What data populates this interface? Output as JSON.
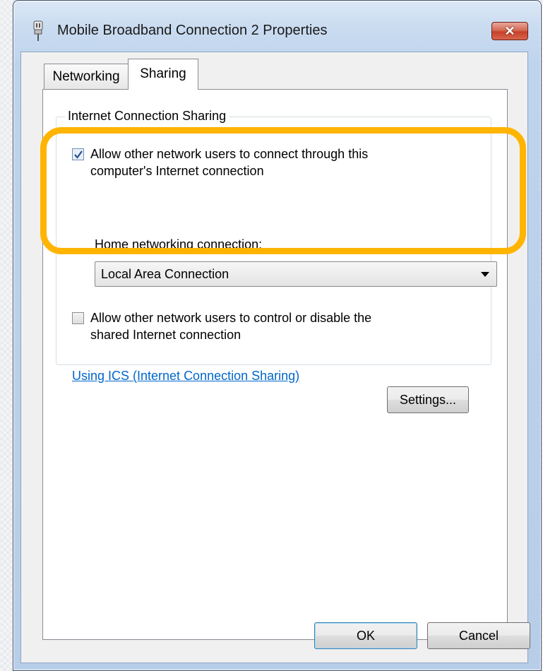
{
  "window": {
    "title": "Mobile Broadband Connection 2 Properties",
    "close_label": "✕"
  },
  "tabs": [
    {
      "label": "Networking",
      "selected": false
    },
    {
      "label": "Sharing",
      "selected": true
    }
  ],
  "sharing": {
    "group_title": "Internet Connection Sharing",
    "allow_connect": {
      "checked": true,
      "line1": "Allow other network users to connect through this",
      "line2": "computer's Internet connection"
    },
    "home_networking_label": "Home networking connection:",
    "home_networking_value": "Local Area Connection",
    "allow_control": {
      "checked": false,
      "line1": "Allow other network users to control or disable the",
      "line2": "shared Internet connection"
    },
    "ics_link": "Using ICS (Internet Connection Sharing)",
    "settings_button": "Settings..."
  },
  "footer": {
    "ok_button": "OK",
    "cancel_button": "Cancel"
  },
  "colors": {
    "highlight": "#ffb400",
    "link": "#0066cc",
    "close_button": "#c7412a"
  },
  "icons": [
    "connection-plug-icon",
    "close-icon",
    "checkmark-icon",
    "dropdown-arrow-icon"
  ]
}
